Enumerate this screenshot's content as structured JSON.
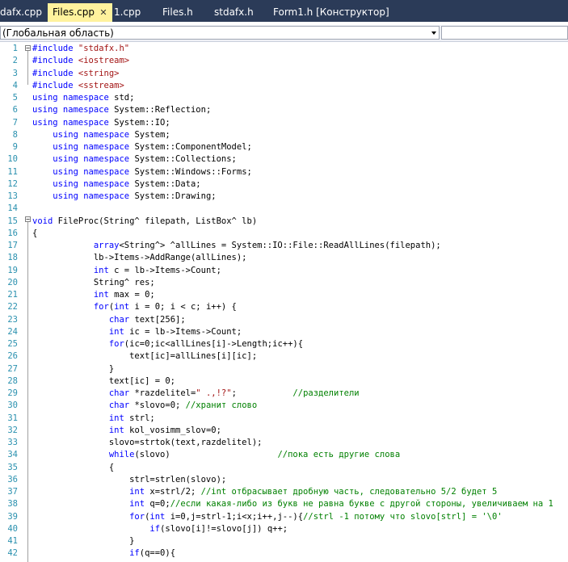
{
  "tabs": [
    {
      "label": "dafx.cpp",
      "active": false
    },
    {
      "label": "Files.cpp",
      "active": true
    },
    {
      "label": "1.cpp",
      "active": false
    },
    {
      "label": "Files.h",
      "active": false
    },
    {
      "label": "stdafx.h",
      "active": false
    },
    {
      "label": "Form1.h [Конструктор]",
      "active": false
    }
  ],
  "tab_close_glyph": "✕",
  "scope": {
    "value": "(Глобальная область)"
  },
  "colors": {
    "keyword": "#0000ff",
    "string": "#a31515",
    "comment": "#008000",
    "line_number": "#2b91af",
    "active_tab": "#fff29d",
    "tab_bar": "#2b3b58"
  },
  "editor": {
    "lines": [
      {
        "n": "1",
        "segs": [
          [
            "pp",
            "#include "
          ],
          [
            "str",
            "\"stdafx.h\""
          ]
        ]
      },
      {
        "n": "2",
        "segs": [
          [
            "pp",
            "#include "
          ],
          [
            "str",
            "<iostream>"
          ]
        ]
      },
      {
        "n": "3",
        "segs": [
          [
            "pp",
            "#include "
          ],
          [
            "str",
            "<string>"
          ]
        ]
      },
      {
        "n": "4",
        "segs": [
          [
            "pp",
            "#include "
          ],
          [
            "str",
            "<sstream>"
          ]
        ]
      },
      {
        "n": "5",
        "segs": [
          [
            "kw",
            "using namespace"
          ],
          [
            "",
            "std;"
          ]
        ]
      },
      {
        "n": "6",
        "segs": [
          [
            "kw",
            "using namespace"
          ],
          [
            "",
            "System::Reflection;"
          ]
        ]
      },
      {
        "n": "7",
        "segs": [
          [
            "kw",
            "using namespace"
          ],
          [
            "",
            "System::IO;"
          ]
        ]
      },
      {
        "n": "8",
        "segs": [
          [
            "",
            "    "
          ],
          [
            "kw",
            "using namespace"
          ],
          [
            "",
            "System;"
          ]
        ]
      },
      {
        "n": "9",
        "segs": [
          [
            "",
            "    "
          ],
          [
            "kw",
            "using namespace"
          ],
          [
            "",
            "System::ComponentModel;"
          ]
        ]
      },
      {
        "n": "10",
        "segs": [
          [
            "",
            "    "
          ],
          [
            "kw",
            "using namespace"
          ],
          [
            "",
            "System::Collections;"
          ]
        ]
      },
      {
        "n": "11",
        "segs": [
          [
            "",
            "    "
          ],
          [
            "kw",
            "using namespace"
          ],
          [
            "",
            "System::Windows::Forms;"
          ]
        ]
      },
      {
        "n": "12",
        "segs": [
          [
            "",
            "    "
          ],
          [
            "kw",
            "using namespace"
          ],
          [
            "",
            "System::Data;"
          ]
        ]
      },
      {
        "n": "13",
        "segs": [
          [
            "",
            "    "
          ],
          [
            "kw",
            "using namespace"
          ],
          [
            "",
            "System::Drawing;"
          ]
        ]
      },
      {
        "n": "14",
        "segs": []
      },
      {
        "n": "15",
        "segs": [
          [
            "kw",
            "void"
          ],
          [
            "",
            "FileProc(String^ filepath, ListBox^ lb)"
          ]
        ]
      },
      {
        "n": "16",
        "segs": [
          [
            "",
            "{"
          ]
        ]
      },
      {
        "n": "17",
        "segs": [
          [
            "",
            "            "
          ],
          [
            "kw",
            "array"
          ],
          [
            "",
            "<String^> ^allLines = System::IO::File::ReadAllLines(filepath);"
          ]
        ]
      },
      {
        "n": "18",
        "segs": [
          [
            "",
            "            lb->Items->AddRange(allLines);"
          ]
        ]
      },
      {
        "n": "19",
        "segs": [
          [
            "",
            "            "
          ],
          [
            "kw",
            "int"
          ],
          [
            "",
            "c = lb->Items->Count;"
          ]
        ]
      },
      {
        "n": "20",
        "segs": [
          [
            "",
            "            String^ res;"
          ]
        ]
      },
      {
        "n": "21",
        "segs": [
          [
            "",
            "            "
          ],
          [
            "kw",
            "int"
          ],
          [
            "",
            "max = 0;"
          ]
        ]
      },
      {
        "n": "22",
        "segs": [
          [
            "",
            "            "
          ],
          [
            "kw",
            "for"
          ],
          [
            "",
            "("
          ],
          [
            "kw",
            "int"
          ],
          [
            "",
            "i = 0; i < c; i++) {"
          ]
        ]
      },
      {
        "n": "23",
        "segs": [
          [
            "",
            "               "
          ],
          [
            "kw",
            "char"
          ],
          [
            "",
            "text[256];"
          ]
        ]
      },
      {
        "n": "24",
        "segs": [
          [
            "",
            "               "
          ],
          [
            "kw",
            "int"
          ],
          [
            "",
            "ic = lb->Items->Count;"
          ]
        ]
      },
      {
        "n": "25",
        "segs": [
          [
            "",
            "               "
          ],
          [
            "kw",
            "for"
          ],
          [
            "",
            "(ic=0;ic<allLines[i]->Length;ic++){"
          ]
        ]
      },
      {
        "n": "26",
        "segs": [
          [
            "",
            "                   text[ic]=allLines[i][ic];"
          ]
        ]
      },
      {
        "n": "27",
        "segs": [
          [
            "",
            "               }"
          ]
        ]
      },
      {
        "n": "28",
        "segs": [
          [
            "",
            "               text[ic] = 0;"
          ]
        ]
      },
      {
        "n": "29",
        "segs": [
          [
            "",
            "               "
          ],
          [
            "kw",
            "char"
          ],
          [
            "",
            "*razdelitel="
          ],
          [
            "str",
            "\" .,!?\""
          ],
          [
            "",
            ";           "
          ],
          [
            "cm",
            "//разделители"
          ]
        ]
      },
      {
        "n": "30",
        "segs": [
          [
            "",
            "               "
          ],
          [
            "kw",
            "char"
          ],
          [
            "",
            "*slovo=0; "
          ],
          [
            "cm",
            "//хранит слово"
          ]
        ]
      },
      {
        "n": "31",
        "segs": [
          [
            "",
            "               "
          ],
          [
            "kw",
            "int"
          ],
          [
            "",
            "strl;"
          ]
        ]
      },
      {
        "n": "32",
        "segs": [
          [
            "",
            "               "
          ],
          [
            "kw",
            "int"
          ],
          [
            "",
            "kol_vosimm_slov=0;"
          ]
        ]
      },
      {
        "n": "33",
        "segs": [
          [
            "",
            "               slovo=strtok(text,razdelitel);"
          ]
        ]
      },
      {
        "n": "34",
        "segs": [
          [
            "",
            "               "
          ],
          [
            "kw",
            "while"
          ],
          [
            "",
            "(slovo)                     "
          ],
          [
            "cm",
            "//пока есть другие слова"
          ]
        ]
      },
      {
        "n": "35",
        "segs": [
          [
            "",
            "               {"
          ]
        ]
      },
      {
        "n": "36",
        "segs": [
          [
            "",
            "                   strl=strlen(slovo);"
          ]
        ]
      },
      {
        "n": "37",
        "segs": [
          [
            "",
            "                   "
          ],
          [
            "kw",
            "int"
          ],
          [
            "",
            "x=strl/2; "
          ],
          [
            "cm",
            "//int отбрасывает дробную часть, следовательно 5/2 будет 5"
          ]
        ]
      },
      {
        "n": "38",
        "segs": [
          [
            "",
            "                   "
          ],
          [
            "kw",
            "int"
          ],
          [
            "",
            "q=0;"
          ],
          [
            "cm",
            "//если какая-либо из букв не равна букве с другой стороны, увеличиваем на 1"
          ]
        ]
      },
      {
        "n": "39",
        "segs": [
          [
            "",
            "                   "
          ],
          [
            "kw",
            "for"
          ],
          [
            "",
            "("
          ],
          [
            "kw",
            "int"
          ],
          [
            "",
            "i=0,j=strl-1;i<x;i++,j--){"
          ],
          [
            "cm",
            "//strl -1 потому что slovo[strl] = '\\0'"
          ]
        ]
      },
      {
        "n": "40",
        "segs": [
          [
            "",
            "                       "
          ],
          [
            "kw",
            "if"
          ],
          [
            "",
            "(slovo[i]!=slovo[j]) q++;"
          ]
        ]
      },
      {
        "n": "41",
        "segs": [
          [
            "",
            "                   }"
          ]
        ]
      },
      {
        "n": "42",
        "segs": [
          [
            "",
            "                   "
          ],
          [
            "kw",
            "if"
          ],
          [
            "",
            "(q==0){"
          ]
        ]
      }
    ]
  }
}
